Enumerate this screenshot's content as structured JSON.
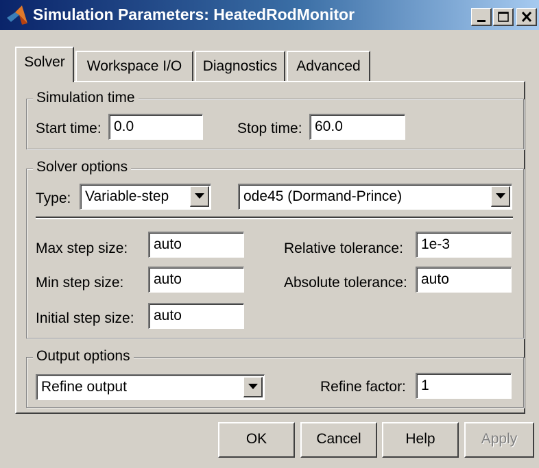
{
  "window": {
    "title": "Simulation Parameters: HeatedRodMonitor",
    "title_bar_color": "#0a246a",
    "app_icon": "matlab-icon",
    "controls": [
      "minimize-icon",
      "maximize-icon",
      "close-icon"
    ]
  },
  "tabs": [
    {
      "label": "Solver",
      "active": true
    },
    {
      "label": "Workspace I/O",
      "active": false
    },
    {
      "label": "Diagnostics",
      "active": false
    },
    {
      "label": "Advanced",
      "active": false
    }
  ],
  "simulation_time": {
    "legend": "Simulation time",
    "start_label": "Start time:",
    "start_value": "0.0",
    "stop_label": "Stop time:",
    "stop_value": "60.0"
  },
  "solver_options": {
    "legend": "Solver options",
    "type_label": "Type:",
    "type_value": "Variable-step",
    "solver_value": "ode45 (Dormand-Prince)",
    "max_step_label": "Max step size:",
    "max_step_value": "auto",
    "min_step_label": "Min step size:",
    "min_step_value": "auto",
    "initial_step_label": "Initial step size:",
    "initial_step_value": "auto",
    "rel_tol_label": "Relative tolerance:",
    "rel_tol_value": "1e-3",
    "abs_tol_label": "Absolute tolerance:",
    "abs_tol_value": "auto"
  },
  "output_options": {
    "legend": "Output options",
    "mode_value": "Refine output",
    "refine_label": "Refine factor:",
    "refine_value": "1"
  },
  "buttons": {
    "ok": "OK",
    "cancel": "Cancel",
    "help": "Help",
    "apply": "Apply",
    "apply_enabled": false
  }
}
